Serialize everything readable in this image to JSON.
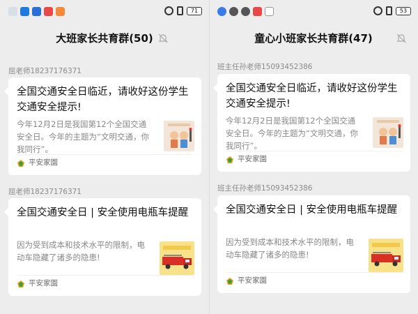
{
  "panes": [
    {
      "battery": "71",
      "group_title": "大班家长共育群(50)",
      "messages": [
        {
          "sender": "屈老师18237176371",
          "title": "全国交通安全日临近，请收好这份学生交通安全提示!",
          "desc": "今年12月2日是我国第12个全国交通安全日。今年的主题为“文明交通，你我同行”。",
          "thumb": "traffic-kids-thumbnail",
          "source": "平安家園"
        },
        {
          "sender": "屈老师18237176371",
          "title": "全国交通安全日 | 安全使用电瓶车提醒",
          "desc": "因为受到成本和技术水平的限制，电动车隐藏了诸多的隐患!",
          "thumb": "fire-truck-thumbnail",
          "source": "平安家園"
        }
      ]
    },
    {
      "battery": "53",
      "group_title": "童心小班家长共育群(47)",
      "messages": [
        {
          "sender": "班主任孙老师15093452386",
          "title": "全国交通安全日临近，请收好这份学生交通安全提示!",
          "desc": "今年12月2日是我国第12个全国交通安全日。今年的主题为“文明交通，你我同行”。",
          "thumb": "traffic-kids-thumbnail",
          "source": "平安家園"
        },
        {
          "sender": "班主任孙老师15093452386",
          "title": "全国交通安全日 | 安全使用电瓶车提醒",
          "desc": "因为受到成本和技术水平的限制，电动车隐藏了诸多的隐患!",
          "thumb": "fire-truck-thumbnail",
          "source": "平安家園"
        }
      ]
    }
  ],
  "colors": {
    "chat_background": "#ededed",
    "card_background": "#ffffff",
    "sender_text": "#8a8a8a",
    "title_text": "#111111",
    "desc_text": "#888888"
  }
}
